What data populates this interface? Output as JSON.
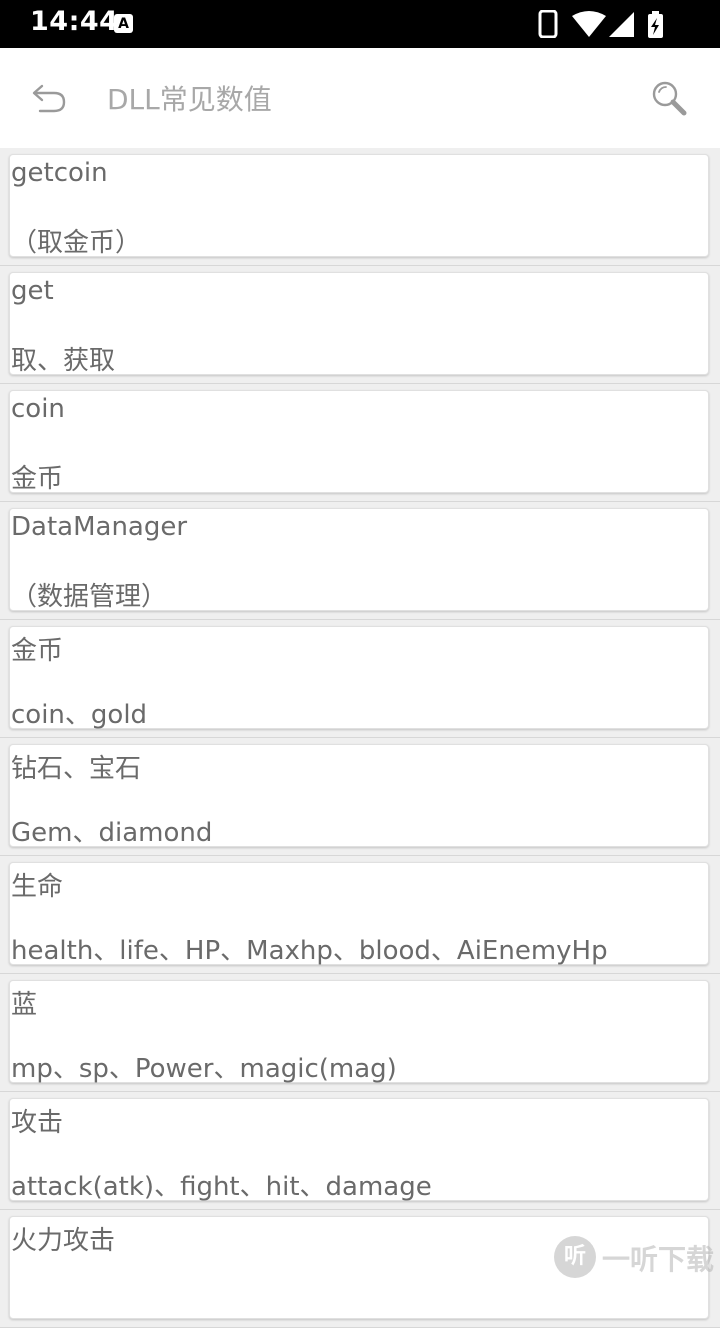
{
  "status_bar": {
    "time": "14:44",
    "notification_badge": "A",
    "icons": [
      "phone-icon",
      "wifi-icon",
      "signal-icon",
      "battery-charging-icon"
    ]
  },
  "app_bar": {
    "title": "DLL常见数值",
    "back_icon": "back-arrow-icon",
    "search_icon": "search-icon"
  },
  "items": [
    {
      "term": "getcoin",
      "meaning": "（取金币）"
    },
    {
      "term": "get",
      "meaning": "取、获取"
    },
    {
      "term": "coin",
      "meaning": "金币"
    },
    {
      "term": "DataManager",
      "meaning": "（数据管理）"
    },
    {
      "term": "金币",
      "meaning": "coin、gold"
    },
    {
      "term": "钻石、宝石",
      "meaning": "Gem、diamond"
    },
    {
      "term": "生命",
      "meaning": "health、life、HP、Maxhp、blood、AiEnemyHp"
    },
    {
      "term": "蓝",
      "meaning": "mp、sp、Power、magic(mag)"
    },
    {
      "term": "攻击",
      "meaning": "attack(atk)、fight、hit、damage"
    },
    {
      "term": "火力攻击",
      "meaning": ""
    }
  ],
  "watermark": {
    "glyph": "听",
    "text": "一听下载"
  }
}
